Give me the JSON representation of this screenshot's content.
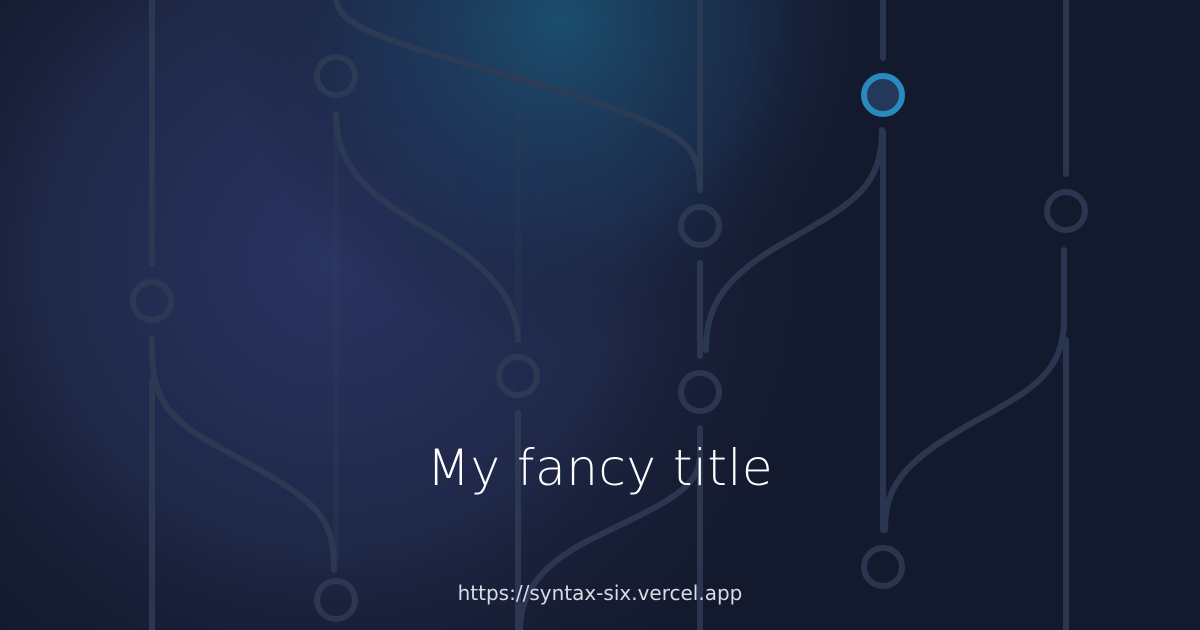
{
  "og_image": {
    "title": "My fancy title",
    "url": "https://syntax-six.vercel.app"
  },
  "colors": {
    "background": "#141a2e",
    "branch_line": "#2f3c55",
    "active_node": "#2a89bf",
    "title_text": "#ffffff",
    "url_text": "#d8dce6"
  },
  "decoration": {
    "pattern": "git-branch-graph-icon"
  }
}
